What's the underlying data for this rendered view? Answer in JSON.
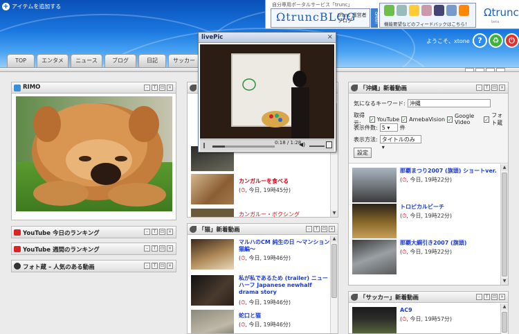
{
  "header": {
    "add_item": "アイテムを追加する",
    "promo_title": "自分専用ポータルサービス「trunc」",
    "blog_logo": "ΩtruncBLOG",
    "blog_sub": "trunc 運営者ブログ",
    "open_tag": "OPEN!!",
    "feedback_text": "機能要望などのフィードバックはこちら！",
    "brand_logo": "Ωtrunc",
    "brand_sub": "beta",
    "welcome": "ようこそ、xtone さん",
    "help_icon": "?",
    "recycle_icon": "♻",
    "power_icon": "⏻"
  },
  "tabs": [
    "TOP",
    "エンタメ",
    "ニュース",
    "ブログ",
    "日記",
    "サッカー"
  ],
  "panel_ctrls": [
    "–",
    "T",
    "⊡",
    "×"
  ],
  "rimo": {
    "title": "RIMO"
  },
  "collapsed_panels": [
    {
      "title": "YouTube 今日のランキング"
    },
    {
      "title": "YouTube 週間のランキング"
    },
    {
      "title": "フォト蔵 – 人気のある動画"
    }
  ],
  "popup": {
    "title": "livePic",
    "close": "×",
    "time": "0:18 / 1:28"
  },
  "middle_top": {
    "title_fragment": "「",
    "items": [
      {
        "title": "カンガルーを食べる",
        "meta_date": "今日, 19時45分)"
      },
      {
        "title": "カンガルー・ボクシング"
      }
    ]
  },
  "cat_panel": {
    "title": "「猫」新着動画",
    "items": [
      {
        "title": "マルハのCM 純生の日 ～マンション猫編～",
        "meta_date": "今日, 19時46分)"
      },
      {
        "title": "私が私であるため (trailer) ニューハーフ Japanese newhalf drama story",
        "meta_date": "今日, 19時46分)"
      },
      {
        "title": "蛇口と猫",
        "meta_date": "今日, 19時46分)"
      }
    ]
  },
  "okinawa_panel": {
    "title": "「沖縄」新着動画",
    "keyword_label": "気になるキーワード:",
    "keyword_value": "沖縄",
    "source_label": "取得元:",
    "sources": [
      "YouTube",
      "AmebaVision",
      "Google Video",
      "フォト蔵"
    ],
    "count_label": "表示件数:",
    "count_value": "5",
    "count_unit": "件",
    "display_label": "表示方法:",
    "display_value": "タイトルのみ",
    "settings_button": "設定",
    "items": [
      {
        "title": "那覇まつり2007 (旗頭) ショートver.",
        "meta_date": "今日, 19時22分)"
      },
      {
        "title": "トロピカルビーチ",
        "meta_date": "今日, 19時22分)"
      },
      {
        "title": "那覇大綱引き2007 (旗頭)",
        "meta_date": "今日, 19時22分)"
      }
    ]
  },
  "soccer_panel": {
    "title": "「サッカー」新着動画",
    "items": [
      {
        "title": "AC9",
        "meta_date": "今日, 19時57分)"
      }
    ]
  },
  "colors": {
    "header_blue": "#1a78e0",
    "link_blue": "#1a3ad8",
    "date_red": "#dd0011"
  }
}
